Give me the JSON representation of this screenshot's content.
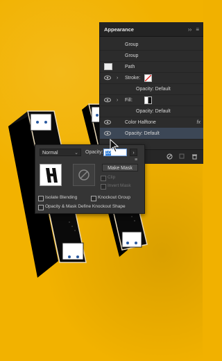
{
  "panel": {
    "title": "Appearance",
    "collapse_icon": "double-chevron-right-icon",
    "menu_icon": "hamburger-icon",
    "rows": [
      {
        "label": "Group"
      },
      {
        "label": "Group"
      },
      {
        "label": "Path"
      },
      {
        "label": "Stroke:",
        "swatch": "none-slash"
      },
      {
        "label": "Opacity: Default"
      },
      {
        "label": "Fill:",
        "swatch": "gradient"
      },
      {
        "label": "Opacity: Default"
      },
      {
        "label": "Color Halftone",
        "fx": "fx"
      },
      {
        "label": "Opacity: Default"
      }
    ]
  },
  "transparency": {
    "blend_mode": "Normal",
    "opacity_label": "Opacity:",
    "opacity_value": "10",
    "make_mask_label": "Make Mask",
    "clip_label": "Clip",
    "invert_mask_label": "Invert Mask",
    "isolate_blending_label": "Isolate Blending",
    "knockout_group_label": "Knockout Group",
    "opacity_mask_label": "Opacity & Mask Define Knockout Shape"
  },
  "colors": {
    "canvas": "#f2b200",
    "panel_bg": "#2c2c2c",
    "selected_row": "#3c4756",
    "highlight": "#2a7bd8"
  }
}
